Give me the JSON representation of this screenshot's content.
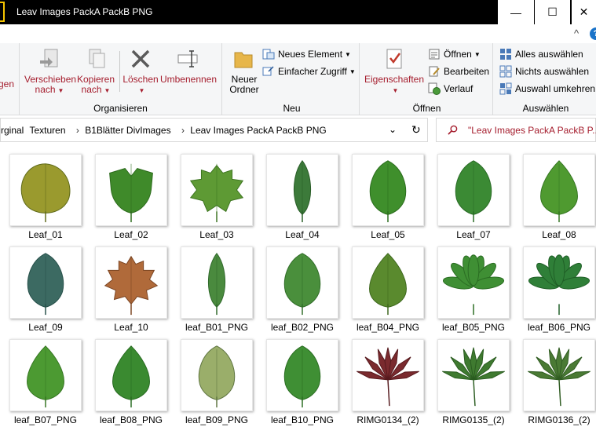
{
  "window": {
    "title": "Leav Images PackA PackB PNG",
    "min_glyph": "—",
    "max_glyph": "☐",
    "close_glyph": "✕",
    "collapse_glyph": "^",
    "help_glyph": "?"
  },
  "ribbon": {
    "partial_label": "gen",
    "organisieren": {
      "label": "Organisieren",
      "move_line1": "Verschieben",
      "move_line2": "nach",
      "copy_line1": "Kopieren",
      "copy_line2": "nach",
      "delete": "Löschen",
      "rename": "Umbenennen"
    },
    "neu": {
      "label": "Neu",
      "new_folder_line1": "Neuer",
      "new_folder_line2": "Ordner",
      "new_item": "Neues Element",
      "easy_access": "Einfacher Zugriff"
    },
    "oeffnen": {
      "label": "Öffnen",
      "properties": "Eigenschaften",
      "open": "Öffnen",
      "edit": "Bearbeiten",
      "history": "Verlauf"
    },
    "auswaehlen": {
      "label": "Auswählen",
      "select_all": "Alles auswählen",
      "select_none": "Nichts auswählen",
      "invert": "Auswahl umkehren"
    }
  },
  "address": {
    "crumbs": [
      "rginal",
      "Texturen",
      "B1Blätter DivImages",
      "Leav Images PackA PackB PNG"
    ],
    "separator": "›",
    "dropdown_glyph": "⌄",
    "refresh_glyph": "↻"
  },
  "search": {
    "text": "\"Leav Images PackA PackB P..."
  },
  "files": [
    {
      "name": "Leaf_01",
      "shape": "round",
      "fill": "#9a9a2e",
      "stroke": "#5f6a1a"
    },
    {
      "name": "Leaf_02",
      "shape": "tulip",
      "fill": "#3f8a2a",
      "stroke": "#2c6a1c"
    },
    {
      "name": "Leaf_03",
      "shape": "grape",
      "fill": "#5e9a34",
      "stroke": "#3c7420"
    },
    {
      "name": "Leaf_04",
      "shape": "narrow",
      "fill": "#3c7a3a",
      "stroke": "#285c26"
    },
    {
      "name": "Leaf_05",
      "shape": "oval",
      "fill": "#3f8f2c",
      "stroke": "#2a6c1c"
    },
    {
      "name": "Leaf_07",
      "shape": "oval",
      "fill": "#3b8a34",
      "stroke": "#286a24"
    },
    {
      "name": "Leaf_08",
      "shape": "heart",
      "fill": "#4f9a30",
      "stroke": "#337420"
    },
    {
      "name": "Leaf_09",
      "shape": "oval",
      "fill": "#3c6a62",
      "stroke": "#27504a"
    },
    {
      "name": "Leaf_10",
      "shape": "maple",
      "fill": "#b06a3a",
      "stroke": "#7a4422"
    },
    {
      "name": "leaf_B01_PNG",
      "shape": "narrow",
      "fill": "#4a8a3e",
      "stroke": "#2f682a"
    },
    {
      "name": "leaf_B02_PNG",
      "shape": "oval",
      "fill": "#4a8f3c",
      "stroke": "#306c28"
    },
    {
      "name": "leaf_B04_PNG",
      "shape": "heart",
      "fill": "#5a8a2e",
      "stroke": "#3c661c"
    },
    {
      "name": "leaf_B05_PNG",
      "shape": "palmate",
      "fill": "#3f8f34",
      "stroke": "#2a6c22"
    },
    {
      "name": "leaf_B06_PNG",
      "shape": "palmate",
      "fill": "#2f7f38",
      "stroke": "#1f5e26"
    },
    {
      "name": "leaf_B07_PNG",
      "shape": "heart",
      "fill": "#4c9a32",
      "stroke": "#347420"
    },
    {
      "name": "leaf_B08_PNG",
      "shape": "heart",
      "fill": "#3a8a30",
      "stroke": "#276a20"
    },
    {
      "name": "leaf_B09_PNG",
      "shape": "oval",
      "fill": "#9aae6a",
      "stroke": "#5e7440"
    },
    {
      "name": "leaf_B10_PNG",
      "shape": "oval",
      "fill": "#3f8f34",
      "stroke": "#2a6c22"
    },
    {
      "name": "RIMG0134_(2)",
      "shape": "japanese",
      "fill": "#7a2a2e",
      "stroke": "#561a1e"
    },
    {
      "name": "RIMG0135_(2)",
      "shape": "japanese",
      "fill": "#3f7a30",
      "stroke": "#2a5c20"
    },
    {
      "name": "RIMG0136_(2)",
      "shape": "japanese",
      "fill": "#4a7a34",
      "stroke": "#305c22"
    }
  ]
}
